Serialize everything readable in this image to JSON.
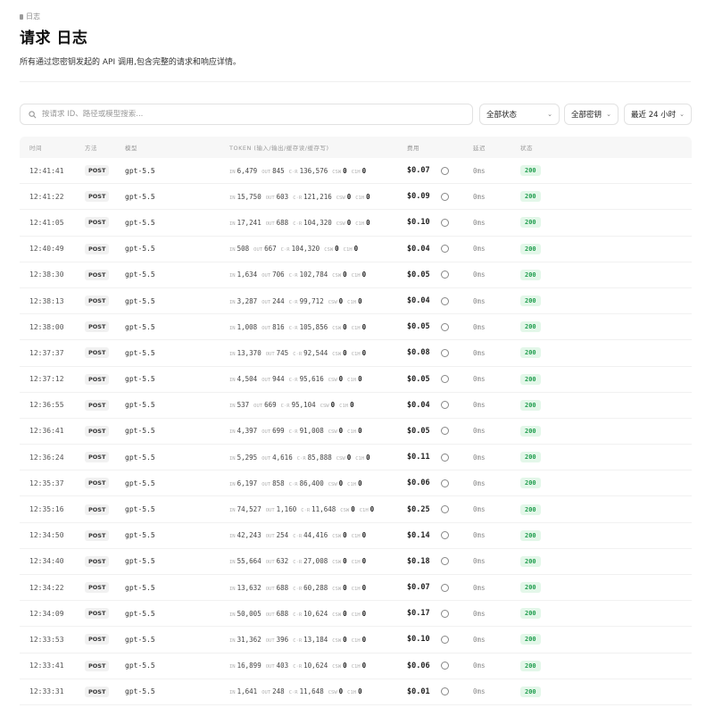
{
  "breadcrumb": "日志",
  "title": "请求 日志",
  "description": "所有通过您密钥发起的 API 调用,包含完整的请求和响应详情。",
  "search": {
    "placeholder": "按请求 ID、路径或模型搜索..."
  },
  "filters": {
    "status": "全部状态",
    "keys": "全部密钥",
    "range": "最近 24 小时"
  },
  "columns": {
    "time": "时间",
    "method": "方法",
    "model": "模型",
    "tokens": "TOKEN (输入/输出/缓存读/缓存写)",
    "cost": "费用",
    "latency": "延迟",
    "status": "状态"
  },
  "token_labels": {
    "in": "IN",
    "out": "OUT",
    "cr": "C·R",
    "csw": "CSW",
    "c1h": "C1H"
  },
  "rows": [
    {
      "time": "12:41:41",
      "method": "POST",
      "model": "gpt-5.5",
      "in": "6,479",
      "out": "845",
      "cr": "136,576",
      "csw": "0",
      "c1h": "0",
      "cost": "$0.07",
      "latency": "0ms",
      "status": "200"
    },
    {
      "time": "12:41:22",
      "method": "POST",
      "model": "gpt-5.5",
      "in": "15,750",
      "out": "603",
      "cr": "121,216",
      "csw": "0",
      "c1h": "0",
      "cost": "$0.09",
      "latency": "0ms",
      "status": "200"
    },
    {
      "time": "12:41:05",
      "method": "POST",
      "model": "gpt-5.5",
      "in": "17,241",
      "out": "688",
      "cr": "104,320",
      "csw": "0",
      "c1h": "0",
      "cost": "$0.10",
      "latency": "0ms",
      "status": "200"
    },
    {
      "time": "12:40:49",
      "method": "POST",
      "model": "gpt-5.5",
      "in": "508",
      "out": "667",
      "cr": "104,320",
      "csw": "0",
      "c1h": "0",
      "cost": "$0.04",
      "latency": "0ms",
      "status": "200"
    },
    {
      "time": "12:38:30",
      "method": "POST",
      "model": "gpt-5.5",
      "in": "1,634",
      "out": "706",
      "cr": "102,784",
      "csw": "0",
      "c1h": "0",
      "cost": "$0.05",
      "latency": "0ms",
      "status": "200"
    },
    {
      "time": "12:38:13",
      "method": "POST",
      "model": "gpt-5.5",
      "in": "3,287",
      "out": "244",
      "cr": "99,712",
      "csw": "0",
      "c1h": "0",
      "cost": "$0.04",
      "latency": "0ms",
      "status": "200"
    },
    {
      "time": "12:38:00",
      "method": "POST",
      "model": "gpt-5.5",
      "in": "1,008",
      "out": "816",
      "cr": "105,856",
      "csw": "0",
      "c1h": "0",
      "cost": "$0.05",
      "latency": "0ms",
      "status": "200"
    },
    {
      "time": "12:37:37",
      "method": "POST",
      "model": "gpt-5.5",
      "in": "13,370",
      "out": "745",
      "cr": "92,544",
      "csw": "0",
      "c1h": "0",
      "cost": "$0.08",
      "latency": "0ms",
      "status": "200"
    },
    {
      "time": "12:37:12",
      "method": "POST",
      "model": "gpt-5.5",
      "in": "4,504",
      "out": "944",
      "cr": "95,616",
      "csw": "0",
      "c1h": "0",
      "cost": "$0.05",
      "latency": "0ms",
      "status": "200"
    },
    {
      "time": "12:36:55",
      "method": "POST",
      "model": "gpt-5.5",
      "in": "537",
      "out": "669",
      "cr": "95,104",
      "csw": "0",
      "c1h": "0",
      "cost": "$0.04",
      "latency": "0ms",
      "status": "200"
    },
    {
      "time": "12:36:41",
      "method": "POST",
      "model": "gpt-5.5",
      "in": "4,397",
      "out": "699",
      "cr": "91,008",
      "csw": "0",
      "c1h": "0",
      "cost": "$0.05",
      "latency": "0ms",
      "status": "200"
    },
    {
      "time": "12:36:24",
      "method": "POST",
      "model": "gpt-5.5",
      "in": "5,295",
      "out": "4,616",
      "cr": "85,888",
      "csw": "0",
      "c1h": "0",
      "cost": "$0.11",
      "latency": "0ms",
      "status": "200"
    },
    {
      "time": "12:35:37",
      "method": "POST",
      "model": "gpt-5.5",
      "in": "6,197",
      "out": "858",
      "cr": "86,400",
      "csw": "0",
      "c1h": "0",
      "cost": "$0.06",
      "latency": "0ms",
      "status": "200"
    },
    {
      "time": "12:35:16",
      "method": "POST",
      "model": "gpt-5.5",
      "in": "74,527",
      "out": "1,160",
      "cr": "11,648",
      "csw": "0",
      "c1h": "0",
      "cost": "$0.25",
      "latency": "0ms",
      "status": "200"
    },
    {
      "time": "12:34:50",
      "method": "POST",
      "model": "gpt-5.5",
      "in": "42,243",
      "out": "254",
      "cr": "44,416",
      "csw": "0",
      "c1h": "0",
      "cost": "$0.14",
      "latency": "0ms",
      "status": "200"
    },
    {
      "time": "12:34:40",
      "method": "POST",
      "model": "gpt-5.5",
      "in": "55,664",
      "out": "632",
      "cr": "27,008",
      "csw": "0",
      "c1h": "0",
      "cost": "$0.18",
      "latency": "0ms",
      "status": "200"
    },
    {
      "time": "12:34:22",
      "method": "POST",
      "model": "gpt-5.5",
      "in": "13,632",
      "out": "688",
      "cr": "60,288",
      "csw": "0",
      "c1h": "0",
      "cost": "$0.07",
      "latency": "0ms",
      "status": "200"
    },
    {
      "time": "12:34:09",
      "method": "POST",
      "model": "gpt-5.5",
      "in": "50,005",
      "out": "688",
      "cr": "10,624",
      "csw": "0",
      "c1h": "0",
      "cost": "$0.17",
      "latency": "0ms",
      "status": "200"
    },
    {
      "time": "12:33:53",
      "method": "POST",
      "model": "gpt-5.5",
      "in": "31,362",
      "out": "396",
      "cr": "13,184",
      "csw": "0",
      "c1h": "0",
      "cost": "$0.10",
      "latency": "0ms",
      "status": "200"
    },
    {
      "time": "12:33:41",
      "method": "POST",
      "model": "gpt-5.5",
      "in": "16,899",
      "out": "403",
      "cr": "10,624",
      "csw": "0",
      "c1h": "0",
      "cost": "$0.06",
      "latency": "0ms",
      "status": "200"
    },
    {
      "time": "12:33:31",
      "method": "POST",
      "model": "gpt-5.5",
      "in": "1,641",
      "out": "248",
      "cr": "11,648",
      "csw": "0",
      "c1h": "0",
      "cost": "$0.01",
      "latency": "0ms",
      "status": "200"
    }
  ],
  "colors": {
    "status_bg": "#e3f7e9",
    "status_fg": "#1f9d4d",
    "header_bg": "#f7f7f7"
  }
}
